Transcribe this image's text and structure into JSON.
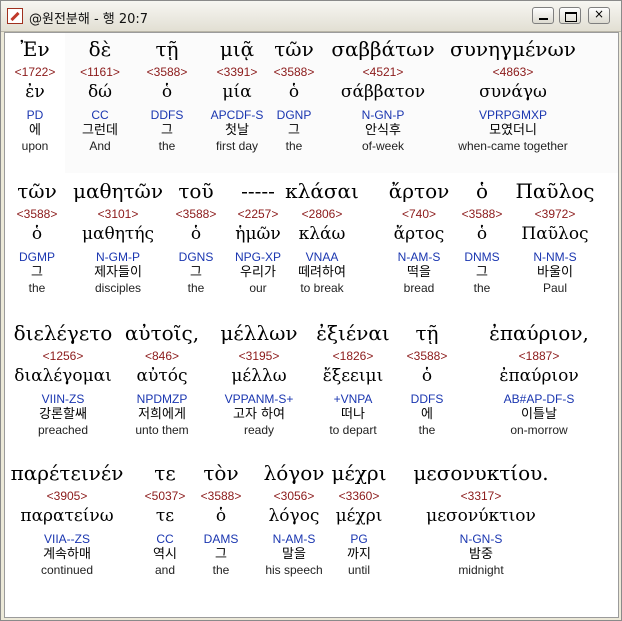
{
  "window": {
    "title": "@원전분해 - 행 20:7",
    "icon": "app-icon"
  },
  "title_buttons": {
    "minimize": "minimize",
    "maximize": "maximize",
    "close": "×"
  },
  "lines": [
    {
      "words": [
        {
          "greek": "Ἐν",
          "strong": "<1722>",
          "lemma": "ἐν",
          "morph": "PD",
          "korean": "에",
          "english": "upon"
        },
        {
          "greek": "δὲ",
          "strong": "<1161>",
          "lemma": "δώ",
          "morph": "CC",
          "korean": "그런데",
          "english": "And"
        },
        {
          "greek": "τῇ",
          "strong": "<3588>",
          "lemma": "ὁ",
          "morph": "DDFS",
          "korean": "그",
          "english": "the"
        },
        {
          "greek": "μιᾷ",
          "strong": "<3391>",
          "lemma": "μία",
          "morph": "APCDF-S",
          "korean": "첫날",
          "english": "first day"
        },
        {
          "greek": "τῶν",
          "strong": "<3588>",
          "lemma": "ὁ",
          "morph": "DGNP",
          "korean": "그",
          "english": "the"
        },
        {
          "greek": "σαββάτων",
          "strong": "<4521>",
          "lemma": "σάββατον",
          "morph": "N-GN-P",
          "korean": "안식후",
          "english": "of-week"
        },
        {
          "greek": "συνηγμένων",
          "strong": "<4863>",
          "lemma": "συνάγω",
          "morph": "VPRPGMXP",
          "korean": "모였더니",
          "english": "when-came together"
        }
      ]
    },
    {
      "words": [
        {
          "greek": "τῶν",
          "strong": "<3588>",
          "lemma": "ὁ",
          "morph": "DGMP",
          "korean": "그",
          "english": "the"
        },
        {
          "greek": "μαθητῶν",
          "strong": "<3101>",
          "lemma": "μαθητής",
          "morph": "N-GM-P",
          "korean": "제자들이",
          "english": "disciples"
        },
        {
          "greek": "τοῦ",
          "strong": "<3588>",
          "lemma": "ὁ",
          "morph": "DGNS",
          "korean": "그",
          "english": "the"
        },
        {
          "greek": "-----",
          "strong": "<2257>",
          "lemma": "ἡμῶν",
          "morph": "NPG-XP",
          "korean": "우리가",
          "english": "our"
        },
        {
          "greek": "κλάσαι",
          "strong": "<2806>",
          "lemma": "κλάω",
          "morph": "VNAA",
          "korean": "떼려하여",
          "english": "to break"
        },
        {
          "greek": "ἄρτον",
          "strong": "<740>",
          "lemma": "ἄρτος",
          "morph": "N-AM-S",
          "korean": "떡을",
          "english": "bread"
        },
        {
          "greek": "ὁ",
          "strong": "<3588>",
          "lemma": "ὁ",
          "morph": "DNMS",
          "korean": "그",
          "english": "the"
        },
        {
          "greek": "Παῦλος",
          "strong": "<3972>",
          "lemma": "Παῦλος",
          "morph": "N-NM-S",
          "korean": "바울이",
          "english": "Paul"
        }
      ]
    },
    {
      "words": [
        {
          "greek": "διελέγετο",
          "strong": "<1256>",
          "lemma": "διαλέγομαι",
          "morph": "VIIN-ZS",
          "korean": "강론할쌔",
          "english": "preached"
        },
        {
          "greek": "αὐτοῖς,",
          "strong": "<846>",
          "lemma": "αὐτός",
          "morph": "NPDMZP",
          "korean": "저희에게",
          "english": "unto them"
        },
        {
          "greek": "μέλλων",
          "strong": "<3195>",
          "lemma": "μέλλω",
          "morph": "VPPANM-S+",
          "korean": "고자 하여",
          "english": "ready"
        },
        {
          "greek": "ἐξιέναι",
          "strong": "<1826>",
          "lemma": "ἔξεειμι",
          "morph": "+VNPA",
          "korean": "떠나",
          "english": "to depart"
        },
        {
          "greek": "τῇ",
          "strong": "<3588>",
          "lemma": "ὁ",
          "morph": "DDFS",
          "korean": "에",
          "english": "the"
        },
        {
          "greek": "ἐπαύριον,",
          "strong": "<1887>",
          "lemma": "ἐπαύριον",
          "morph": "AB#AP-DF-S",
          "korean": "이틀날",
          "english": "on-morrow"
        }
      ]
    },
    {
      "words": [
        {
          "greek": "παρέτεινέν",
          "strong": "<3905>",
          "lemma": "παρατείνω",
          "morph": "VIIA--ZS",
          "korean": "계속하매",
          "english": "continued"
        },
        {
          "greek": "τε",
          "strong": "<5037>",
          "lemma": "τε",
          "morph": "CC",
          "korean": "역시",
          "english": "and"
        },
        {
          "greek": "τὸν",
          "strong": "<3588>",
          "lemma": "ὁ",
          "morph": "DAMS",
          "korean": "그",
          "english": "the"
        },
        {
          "greek": "λόγον",
          "strong": "<3056>",
          "lemma": "λόγος",
          "morph": "N-AM-S",
          "korean": "말을",
          "english": "his speech"
        },
        {
          "greek": "μέχρι",
          "strong": "<3360>",
          "lemma": "μέχρι",
          "morph": "PG",
          "korean": "까지",
          "english": "until"
        },
        {
          "greek": "μεσονυκτίου.",
          "strong": "<3317>",
          "lemma": "μεσονύκτιον",
          "morph": "N-GN-S",
          "korean": "밤중",
          "english": "midnight"
        }
      ]
    }
  ]
}
